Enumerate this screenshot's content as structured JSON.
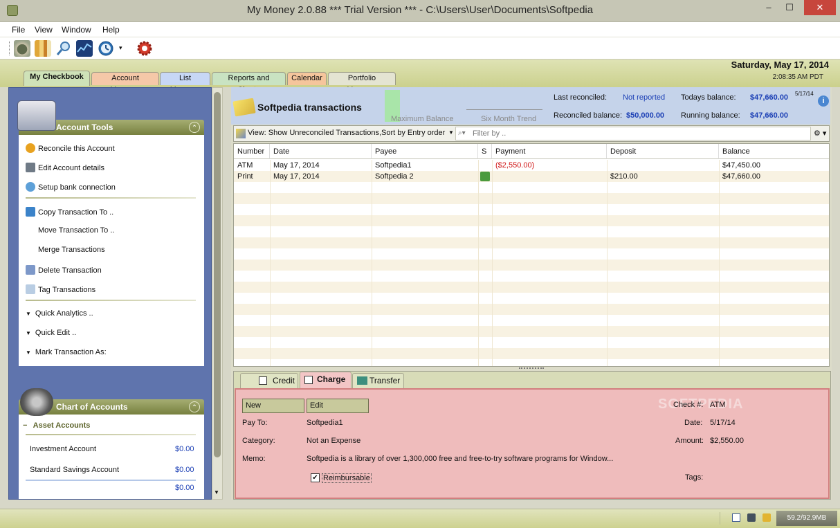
{
  "window": {
    "title": "My Money 2.0.88 *** Trial Version *** - C:\\Users\\User\\Documents\\Softpedia",
    "min": "–",
    "max": "☐",
    "close": "✕"
  },
  "menu": [
    "File",
    "View",
    "Window",
    "Help"
  ],
  "toolbar": {
    "icons": [
      "money-icon",
      "books-icon",
      "search-icon",
      "chart-icon",
      "clock-icon",
      "dropdown-arrow-icon",
      "settings-gear-icon"
    ]
  },
  "header": {
    "date": "Saturday, May 17, 2014",
    "time": "2:08:35 AM PDT"
  },
  "tabs": [
    {
      "label": "My Checkbook",
      "color": "#cfe2b8",
      "active": true
    },
    {
      "label": "Account Manager",
      "color": "#f5c8a8"
    },
    {
      "label": "List Manager",
      "color": "#c7d7f5"
    },
    {
      "label": "Reports and Charts",
      "color": "#c9e3c2"
    },
    {
      "label": "Calendar",
      "color": "#f5c59c"
    },
    {
      "label": "Portfolio Manager",
      "color": "#e4e4d2"
    }
  ],
  "account_tools": {
    "title": "Account Tools",
    "collapse": "⌃",
    "items": [
      "Reconcile this Account",
      "Edit Account details",
      "Setup bank connection",
      "Copy Transaction To ..",
      "Move Transaction To ..",
      "Merge Transactions",
      "Delete Transaction",
      "Tag Transactions"
    ],
    "expanders": [
      "Quick Analytics ..",
      "Quick Edit ..",
      "Mark Transaction As:"
    ]
  },
  "chart_of_accounts": {
    "title": "Chart of Accounts",
    "collapse": "⌃",
    "group": "Asset Accounts",
    "group_toggle": "−",
    "accounts": [
      {
        "name": "Investment Account",
        "amount": "$0.00"
      },
      {
        "name": "Standard Savings Account",
        "amount": "$0.00"
      }
    ],
    "total": "$0.00"
  },
  "account": {
    "title": "Softpedia transactions",
    "max_balance_label": "Maximum Balance",
    "six_month_label": "Six Month Trend",
    "last_reconciled_label": "Last reconciled:",
    "last_reconciled_value": "Not reported",
    "reconciled_balance_label": "Reconciled balance:",
    "reconciled_balance_value": "$50,000.00",
    "todays_balance_label": "Todays balance:",
    "todays_balance_value": "$47,660.00",
    "todays_balance_date": "5/17/14",
    "running_balance_label": "Running balance:",
    "running_balance_value": "$47,660.00",
    "info": "i"
  },
  "view_bar": {
    "view_text": "View: Show Unreconciled Transactions,Sort by Entry order",
    "filter_placeholder": "Filter by ..",
    "gear": "⚙ ▾"
  },
  "grid": {
    "columns": [
      "Number",
      "Date",
      "Payee",
      "S",
      "Payment",
      "Deposit",
      "Balance"
    ],
    "rows": [
      {
        "number": "ATM",
        "date": "May 17, 2014",
        "payee": "Softpedia1",
        "s": "",
        "payment": "($2,550.00)",
        "deposit": "",
        "balance": "$47,450.00"
      },
      {
        "number": "Print",
        "date": "May 17, 2014",
        "payee": "Softpedia 2",
        "s": "print-icon",
        "payment": "",
        "deposit": "$210.00",
        "balance": "$47,660.00"
      }
    ]
  },
  "entry_tabs": [
    "Credit",
    "Charge",
    "Transfer"
  ],
  "form": {
    "new_btn": "New",
    "edit_btn": "Edit",
    "payto_label": "Pay To:",
    "payto": "Softpedia1",
    "category_label": "Category:",
    "category": "Not an Expense",
    "memo_label": "Memo:",
    "memo": "Softpedia is a library of over 1,300,000 free and free-to-try software programs for Window...",
    "check_label": "Check #:",
    "check": "ATM",
    "date_label": "Date:",
    "date": "5/17/14",
    "amount_label": "Amount:",
    "amount": "$2,550.00",
    "reimbursable_label": "Reimbursable",
    "reimbursable_mark": "✔",
    "tags_label": "Tags:",
    "watermark": "SOFTPEDIA"
  },
  "status": {
    "memory": "59.2/92.9MB"
  }
}
